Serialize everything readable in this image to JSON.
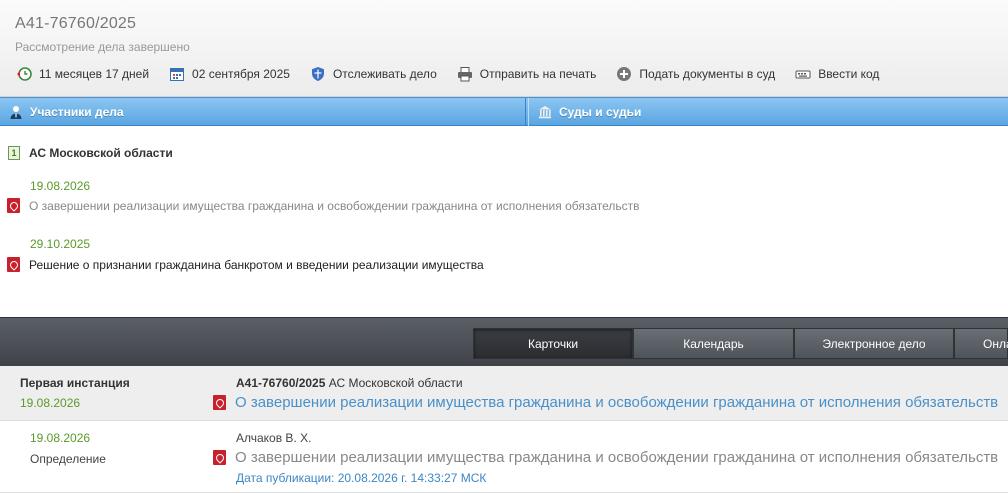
{
  "header": {
    "case_number": "А41-76760/2025",
    "case_status": "Рассмотрение дела завершено",
    "toolbar": [
      {
        "label": "11 месяцев 17 дней",
        "icon": "clock-back-icon"
      },
      {
        "label": "02 сентября 2025",
        "icon": "calendar-icon"
      },
      {
        "label": "Отслеживать дело",
        "icon": "shield-icon"
      },
      {
        "label": "Отправить на печать",
        "icon": "printer-icon"
      },
      {
        "label": "Подать документы в суд",
        "icon": "plus-circle-icon"
      },
      {
        "label": "Ввести код",
        "icon": "keyboard-icon"
      }
    ]
  },
  "sections": {
    "participants_label": "Участники дела",
    "courts_label": "Суды и судьи"
  },
  "court": {
    "number_badge": "1",
    "name": "АС Московской области",
    "documents": [
      {
        "date": "19.08.2026",
        "title": "О завершении реализации имущества гражданина и освобождении гражданина от исполнения обязательств"
      },
      {
        "date": "29.10.2025",
        "title": "Решение о признании гражданина банкротом и введении реализации имущества"
      }
    ]
  },
  "tabs": [
    {
      "label": "Карточки",
      "active": true
    },
    {
      "label": "Календарь",
      "active": false
    },
    {
      "label": "Электронное дело",
      "active": false
    },
    {
      "label": "Онла",
      "active": false
    }
  ],
  "instance": {
    "title": "Первая инстанция",
    "date": "19.08.2026",
    "case_number": "А41-76760/2025",
    "court": "АС Московской области",
    "document_link": "О завершении реализации имущества гражданина и освобождении гражданина от исполнения обязательств"
  },
  "act": {
    "date": "19.08.2026",
    "type": "Определение",
    "judge": "Алчаков В. Х.",
    "document": "О завершении реализации имущества гражданина и освобождении гражданина от исполнения обязательств",
    "published": "Дата публикации: 20.08.2026 г. 14:33:27 МСК"
  },
  "colors": {
    "accent_blue": "#5aa6e2",
    "date_green": "#5b9a2a",
    "pdf_red": "#c8202c",
    "link_blue": "#4a90c8"
  }
}
